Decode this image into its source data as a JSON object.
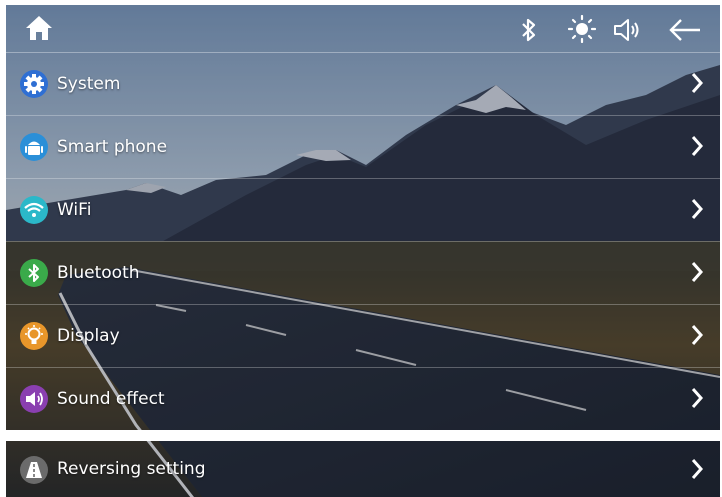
{
  "topbar": {
    "icons": [
      "home-icon",
      "bluetooth-icon",
      "brightness-icon",
      "volume-icon",
      "back-arrow-icon"
    ]
  },
  "menu": [
    {
      "label": "System",
      "icon": "gear-icon",
      "color": "#2f6fd3"
    },
    {
      "label": "Smart phone",
      "icon": "android-icon",
      "color": "#2b8fd8"
    },
    {
      "label": "WiFi",
      "icon": "wifi-icon",
      "color": "#2bb8c9"
    },
    {
      "label": "Bluetooth",
      "icon": "bluetooth-icon",
      "color": "#3aaa4a"
    },
    {
      "label": "Display",
      "icon": "lightbulb-icon",
      "color": "#e8962a"
    },
    {
      "label": "Sound effect",
      "icon": "speaker-icon",
      "color": "#8a3fb0"
    }
  ],
  "second_panel": {
    "label": "Reversing setting",
    "icon": "road-icon",
    "color": "#6b6b6b"
  }
}
